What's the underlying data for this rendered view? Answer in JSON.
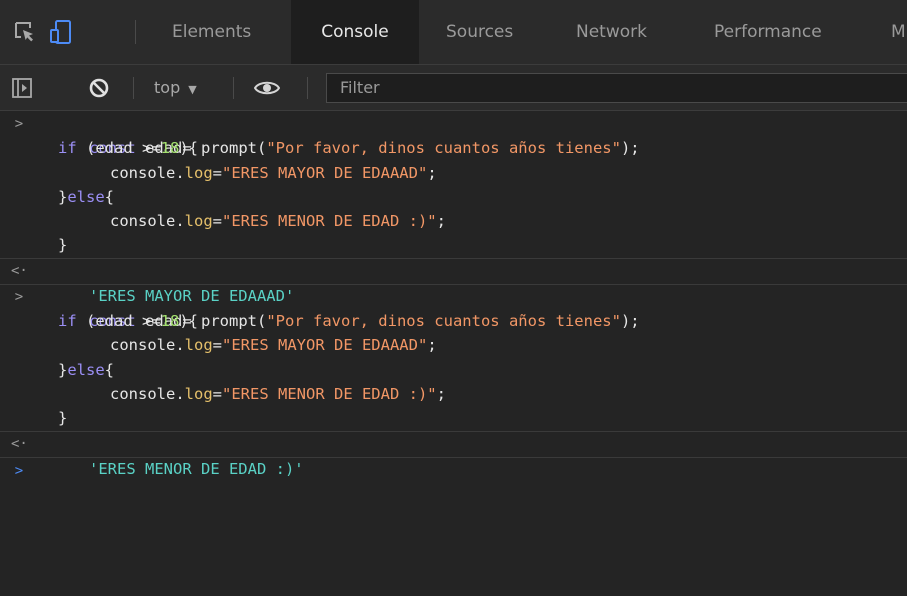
{
  "devtools": {
    "tabs": [
      {
        "label": "Elements",
        "active": false
      },
      {
        "label": "Console",
        "active": true
      },
      {
        "label": "Sources",
        "active": false
      },
      {
        "label": "Network",
        "active": false
      },
      {
        "label": "Performance",
        "active": false
      },
      {
        "label": "M",
        "active": false
      }
    ],
    "icons": [
      "inspect-element-icon",
      "device-toolbar-icon"
    ]
  },
  "console_toolbar": {
    "icons": [
      "sidebar-toggle-icon",
      "clear-console-icon",
      "live-expression-eye-icon"
    ],
    "context_label": "top",
    "context_caret": "▼",
    "filter_placeholder": "Filter"
  },
  "console": {
    "input_glyph": ">",
    "result_glyph": "<·",
    "entries": [
      {
        "code": {
          "l1": {
            "kw": "const",
            "a": " edad= prompt(",
            "s": "\"Por favor, dinos cuantos años tienes\"",
            "b": ");"
          },
          "l2": {
            "kw": "if",
            "a": " (edad >=",
            "n": "18",
            "b": "){"
          },
          "l3": {
            "a": "console.",
            "p": "log",
            "b": "=",
            "s": "\"ERES MAYOR DE EDAAAD\"",
            "c": ";"
          },
          "l4": {
            "a": "}",
            "kw": "else",
            "b": "{"
          },
          "l5": {
            "a": "console.",
            "p": "log",
            "b": "=",
            "s": "\"ERES MENOR DE EDAD :)\"",
            "c": ";"
          },
          "l6": {
            "a": "}"
          }
        },
        "result": "'ERES MAYOR DE EDAAAD'"
      },
      {
        "code": {
          "l1": {
            "kw": "const",
            "a": " edad= prompt(",
            "s": "\"Por favor, dinos cuantos años tienes\"",
            "b": ");"
          },
          "l2": {
            "kw": "if",
            "a": " (edad >=",
            "n": "18",
            "b": "){"
          },
          "l3": {
            "a": "console.",
            "p": "log",
            "b": "=",
            "s": "\"ERES MAYOR DE EDAAAD\"",
            "c": ";"
          },
          "l4": {
            "a": "}",
            "kw": "else",
            "b": "{"
          },
          "l5": {
            "a": "console.",
            "p": "log",
            "b": "=",
            "s": "\"ERES MENOR DE EDAD :)\"",
            "c": ";"
          },
          "l6": {
            "a": "}"
          }
        },
        "result": "'ERES MENOR DE EDAD :)'"
      }
    ],
    "prompt_glyph": ">"
  },
  "colors": {
    "keyword": "#9b8ff5",
    "string": "#f29766",
    "number": "#a3e06e",
    "property": "#e5c06b",
    "result": "#5ad2c6",
    "prompt": "#4d8bf5"
  }
}
